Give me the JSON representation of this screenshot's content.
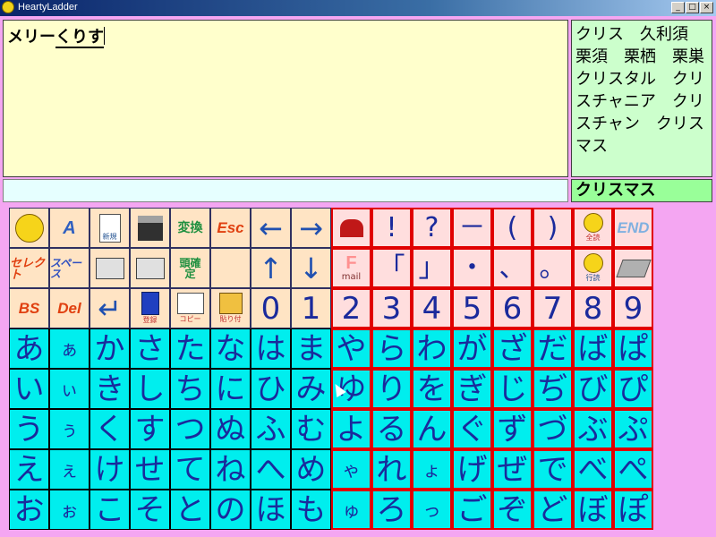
{
  "window": {
    "title": "HeartyLadder"
  },
  "editor": {
    "text_plain": "メリー",
    "text_composing": "くりす"
  },
  "candidates": {
    "text": "クリス　久利須　栗須　栗栖　栗巣　クリスタル　クリスチャニア　クリスチャン　クリスマス"
  },
  "selected_candidate": "クリスマス",
  "keys": {
    "esc": "Esc",
    "bs": "BS",
    "del": "Del",
    "end": "END",
    "a": "A",
    "henkan": "変換",
    "select": "セレクト",
    "space": "スペース",
    "touki": "頭確定",
    "shinki": "新規",
    "touroku": "登録",
    "copy": "コピー",
    "paste": "貼り付",
    "zenyomi": "全読",
    "gyouyomi": "行読",
    "mail": "mail",
    "d0": "0",
    "d1": "1",
    "d2": "2",
    "d3": "3",
    "d4": "4",
    "d5": "5",
    "d6": "6",
    "d7": "7",
    "d8": "8",
    "d9": "9",
    "excl": "!",
    "ques": "?",
    "dash": "－",
    "lparen": "(",
    "rparen": ")",
    "lbracket": "「",
    "rbracket": "」",
    "dot": "・",
    "comma": "、",
    "period": "。"
  },
  "kana": [
    [
      "あ",
      "ぁ",
      "か",
      "さ",
      "た",
      "な",
      "は",
      "ま",
      "や",
      "ら",
      "わ",
      "が",
      "ざ",
      "だ",
      "ば",
      "ぱ"
    ],
    [
      "い",
      "ぃ",
      "き",
      "し",
      "ち",
      "に",
      "ひ",
      "み",
      "ゆ",
      "り",
      "を",
      "ぎ",
      "じ",
      "ぢ",
      "び",
      "ぴ"
    ],
    [
      "う",
      "ぅ",
      "く",
      "す",
      "つ",
      "ぬ",
      "ふ",
      "む",
      "よ",
      "る",
      "ん",
      "ぐ",
      "ず",
      "づ",
      "ぶ",
      "ぷ"
    ],
    [
      "え",
      "ぇ",
      "け",
      "せ",
      "て",
      "ね",
      "へ",
      "め",
      "ゃ",
      "れ",
      "ょ",
      "げ",
      "ぜ",
      "で",
      "べ",
      "ぺ"
    ],
    [
      "お",
      "ぉ",
      "こ",
      "そ",
      "と",
      "の",
      "ほ",
      "も",
      "ゅ",
      "ろ",
      "っ",
      "ご",
      "ぞ",
      "ど",
      "ぼ",
      "ぽ"
    ]
  ],
  "colors": {
    "title_bar": "#0a246a",
    "editor_bg": "#ffffcc",
    "candidate_bg": "#ccffcc",
    "key_cyan": "#00eeee",
    "key_peach": "#ffe4c4",
    "red_border": "#e00000"
  }
}
